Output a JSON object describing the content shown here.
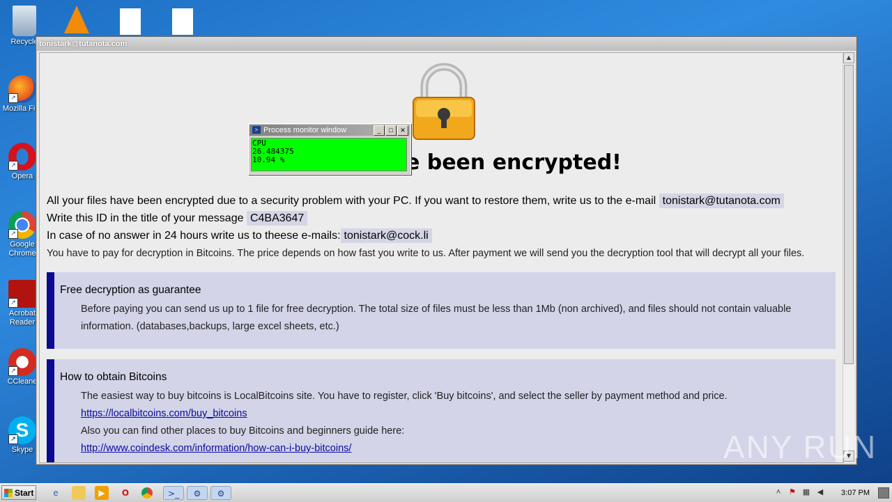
{
  "desktop": {
    "icons": [
      {
        "label": "Recycle"
      },
      {
        "label": "Mozilla Fire"
      },
      {
        "label": "Opera"
      },
      {
        "label": "Google Chrome"
      },
      {
        "label": "Acrobat Reader"
      },
      {
        "label": "CCleane"
      },
      {
        "label": "Skype"
      }
    ]
  },
  "window": {
    "title": "tonistark@tutanota.com",
    "headline": "ave been encrypted!",
    "line1_text": "All your files have been encrypted due to a security problem with your PC. If you want to restore them, write us to the e-mail",
    "line1_email": "tonistark@tutanota.com",
    "line2_text": "Write this ID in the title of your message",
    "line2_id": "C4BA3647",
    "line3_text": "In case of no answer in 24 hours write us to theese e-mails:",
    "line3_email": "tonistark@cock.li",
    "line4_text": "You have to pay for decryption in Bitcoins. The price depends on how fast you write to us. After payment we will send you the decryption tool that will decrypt all your files.",
    "box1": {
      "title": "Free decryption as guarantee",
      "body": "Before paying you can send us up to 1 file for free decryption. The total size of files must be less than 1Mb (non archived), and files should not contain valuable information. (databases,backups, large excel sheets, etc.)"
    },
    "box2": {
      "title": "How to obtain Bitcoins",
      "p1": "The easiest way to buy bitcoins is LocalBitcoins site. You have to register, click 'Buy bitcoins', and select the seller by payment method and price.",
      "link1": "https://localbitcoins.com/buy_bitcoins",
      "p2": "Also you can find other places to buy Bitcoins and beginners guide here:",
      "link2": "http://www.coindesk.com/information/how-can-i-buy-bitcoins/"
    }
  },
  "process_monitor": {
    "title": "Process monitor window",
    "line1": "CPU",
    "line2": "26.484375",
    "line3": "10.94 %"
  },
  "watermark": "ANY RUN",
  "taskbar": {
    "start_label": "Start",
    "time": "3:07 PM"
  }
}
